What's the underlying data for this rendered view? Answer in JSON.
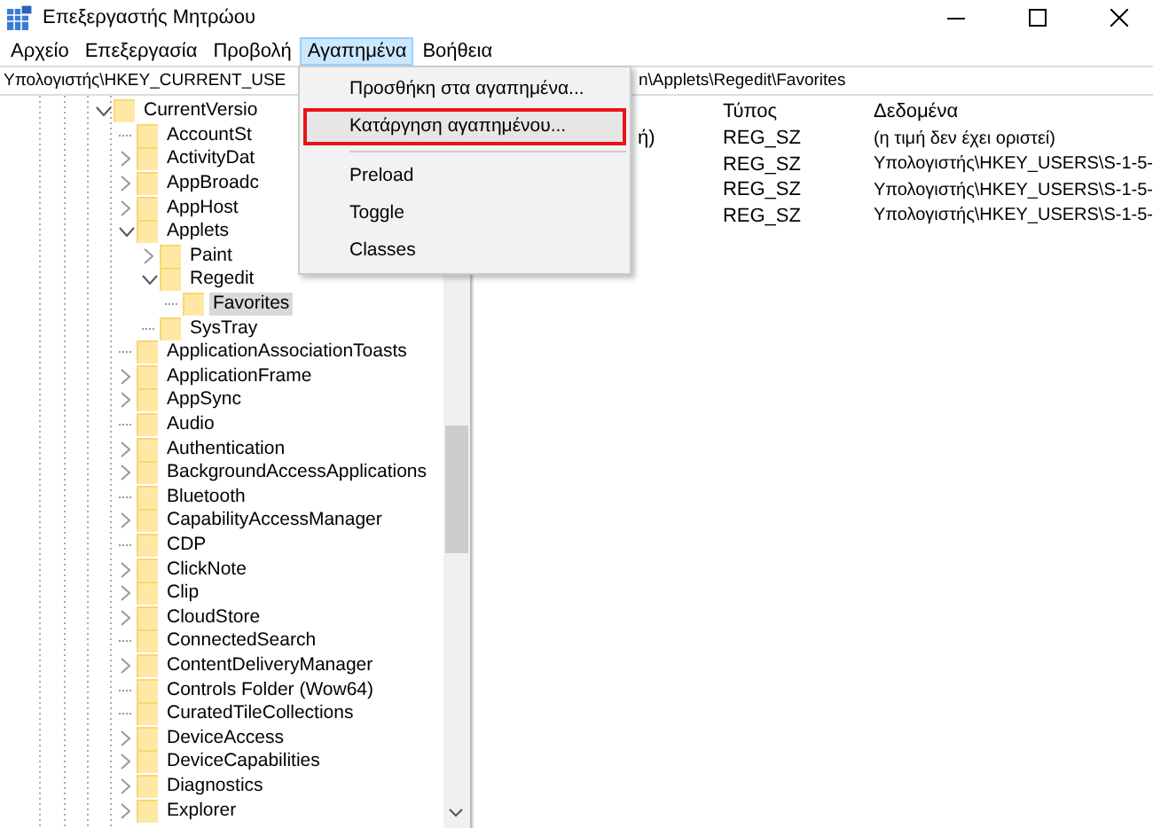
{
  "window": {
    "title": "Επεξεργαστής Μητρώου"
  },
  "menubar": [
    {
      "label": "Αρχείο",
      "selected": false
    },
    {
      "label": "Επεξεργασία",
      "selected": false
    },
    {
      "label": "Προβολή",
      "selected": false
    },
    {
      "label": "Αγαπημένα",
      "selected": true
    },
    {
      "label": "Βοήθεια",
      "selected": false
    }
  ],
  "address": {
    "visible_start": "Υπολογιστής\\HKEY_CURRENT_USE",
    "visible_end": "n\\Applets\\Regedit\\Favorites"
  },
  "favorites_menu": {
    "groups": [
      [
        {
          "label": "Προσθήκη στα αγαπημένα...",
          "highlighted": false
        },
        {
          "label": "Κατάργηση αγαπημένου...",
          "highlighted": true
        }
      ],
      [
        {
          "label": "Preload",
          "highlighted": false
        },
        {
          "label": "Toggle",
          "highlighted": false
        },
        {
          "label": "Classes",
          "highlighted": false
        }
      ]
    ]
  },
  "tree": [
    {
      "label": "CurrentVersio",
      "has_subkeys": true,
      "expanded": true,
      "selected": false,
      "children": [
        {
          "label": "AccountSt",
          "has_subkeys": false,
          "selected": false
        },
        {
          "label": "ActivityDat",
          "has_subkeys": true,
          "expanded": false,
          "selected": false
        },
        {
          "label": "AppBroadc",
          "has_subkeys": true,
          "expanded": false,
          "selected": false
        },
        {
          "label": "AppHost",
          "has_subkeys": true,
          "expanded": false,
          "selected": false
        },
        {
          "label": "Applets",
          "has_subkeys": true,
          "expanded": true,
          "selected": false,
          "children": [
            {
              "label": "Paint",
              "has_subkeys": true,
              "expanded": false,
              "selected": false
            },
            {
              "label": "Regedit",
              "has_subkeys": true,
              "expanded": true,
              "selected": false,
              "children": [
                {
                  "label": "Favorites",
                  "has_subkeys": false,
                  "selected": true
                }
              ]
            },
            {
              "label": "SysTray",
              "has_subkeys": false,
              "selected": false
            }
          ]
        },
        {
          "label": "ApplicationAssociationToasts",
          "has_subkeys": false,
          "selected": false
        },
        {
          "label": "ApplicationFrame",
          "has_subkeys": true,
          "expanded": false,
          "selected": false
        },
        {
          "label": "AppSync",
          "has_subkeys": true,
          "expanded": false,
          "selected": false
        },
        {
          "label": "Audio",
          "has_subkeys": false,
          "selected": false
        },
        {
          "label": "Authentication",
          "has_subkeys": true,
          "expanded": false,
          "selected": false
        },
        {
          "label": "BackgroundAccessApplications",
          "has_subkeys": true,
          "expanded": false,
          "selected": false
        },
        {
          "label": "Bluetooth",
          "has_subkeys": false,
          "selected": false
        },
        {
          "label": "CapabilityAccessManager",
          "has_subkeys": true,
          "expanded": false,
          "selected": false
        },
        {
          "label": "CDP",
          "has_subkeys": false,
          "selected": false
        },
        {
          "label": "ClickNote",
          "has_subkeys": true,
          "expanded": false,
          "selected": false
        },
        {
          "label": "Clip",
          "has_subkeys": true,
          "expanded": false,
          "selected": false
        },
        {
          "label": "CloudStore",
          "has_subkeys": true,
          "expanded": false,
          "selected": false
        },
        {
          "label": "ConnectedSearch",
          "has_subkeys": false,
          "selected": false
        },
        {
          "label": "ContentDeliveryManager",
          "has_subkeys": true,
          "expanded": false,
          "selected": false
        },
        {
          "label": "Controls Folder (Wow64)",
          "has_subkeys": false,
          "selected": false
        },
        {
          "label": "CuratedTileCollections",
          "has_subkeys": false,
          "selected": false
        },
        {
          "label": "DeviceAccess",
          "has_subkeys": true,
          "expanded": false,
          "selected": false
        },
        {
          "label": "DeviceCapabilities",
          "has_subkeys": true,
          "expanded": false,
          "selected": false
        },
        {
          "label": "Diagnostics",
          "has_subkeys": true,
          "expanded": false,
          "selected": false
        },
        {
          "label": "Explorer",
          "has_subkeys": true,
          "expanded": false,
          "selected": false
        }
      ]
    }
  ],
  "values": {
    "columns": [
      "Τύπος",
      "Δεδομένα"
    ],
    "rows": [
      {
        "name": "ή)",
        "type": "REG_SZ",
        "data": "(η τιμή δεν έχει οριστεί)"
      },
      {
        "type": "REG_SZ",
        "data": "Υπολογιστής\\HKEY_USERS\\S-1-5-"
      },
      {
        "type": "REG_SZ",
        "data": "Υπολογιστής\\HKEY_USERS\\S-1-5-"
      },
      {
        "type": "REG_SZ",
        "data": "Υπολογιστής\\HKEY_USERS\\S-1-5-"
      }
    ]
  }
}
